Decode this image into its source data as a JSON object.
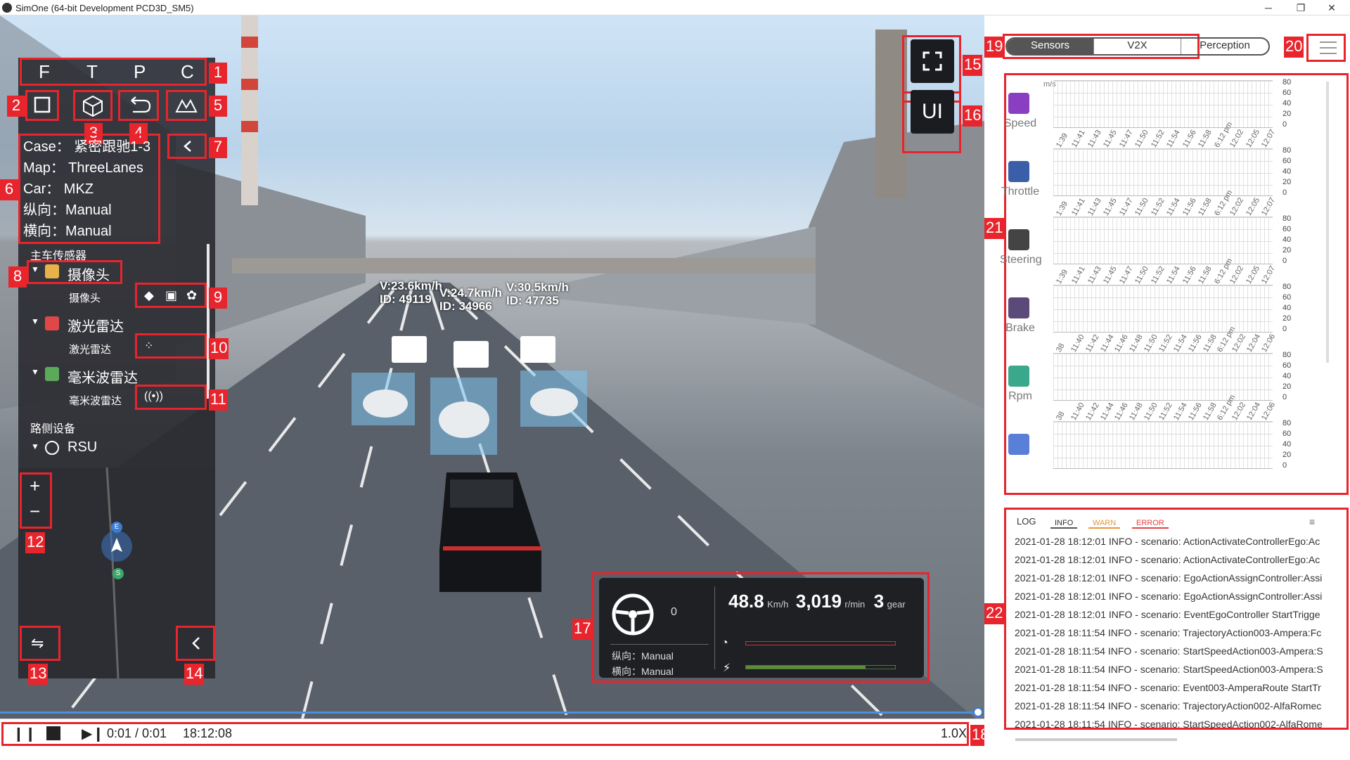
{
  "window": {
    "title": "SimOne (64-bit Development PCD3D_SM5)"
  },
  "view_modes": [
    "F",
    "T",
    "P",
    "C"
  ],
  "toolbar_icons": [
    "square-view-icon",
    "cube-view-icon",
    "undo-icon",
    "terrain-icon"
  ],
  "case_info": {
    "case_label": "Case：",
    "case_value": "紧密跟驰1-3",
    "map_label": "Map：",
    "map_value": "ThreeLanes",
    "car_label": "Car：",
    "car_value": "MKZ",
    "long_label": "纵向：",
    "long_value": "Manual",
    "lat_label": "横向：",
    "lat_value": "Manual"
  },
  "sensors": {
    "section_title": "主车传感器",
    "groups": [
      {
        "name": "摄像头",
        "item": "摄像头",
        "color": "#e8b24a"
      },
      {
        "name": "激光雷达",
        "item": "激光雷达",
        "color": "#e04848"
      },
      {
        "name": "毫米波雷达",
        "item": "毫米波雷达",
        "color": "#5aaa5a"
      }
    ],
    "roadside_title": "路侧设备",
    "roadside_item": "RSU"
  },
  "vehicles": [
    {
      "speed": "V:23.6km/h",
      "id": "ID:  49119"
    },
    {
      "speed": "V:24.7km/h",
      "id": "ID:  34966"
    },
    {
      "speed": "V:30.5km/h",
      "id": "ID:  47735"
    }
  ],
  "minimap": {
    "zoom_in": "+",
    "zoom_out": "−",
    "marker_e": "E",
    "marker_s": "S"
  },
  "dashboard": {
    "steer_value": "0",
    "long_label": "纵向：",
    "long_value": "Manual",
    "lat_label": "横向：",
    "lat_value": "Manual",
    "speed": "48.8",
    "speed_unit": "Km/h",
    "rpm": "3,019",
    "rpm_unit": "r/min",
    "gear": "3",
    "gear_unit": "gear",
    "brake_level": 0.0,
    "throttle_level": 0.8
  },
  "ui_button": "UI",
  "callouts": [
    "1",
    "2",
    "3",
    "4",
    "5",
    "6",
    "7",
    "8",
    "9",
    "10",
    "11",
    "12",
    "13",
    "14",
    "15",
    "16",
    "17",
    "18",
    "19",
    "20",
    "21",
    "22"
  ],
  "right_tabs": [
    "Sensors",
    "V2X",
    "Perception"
  ],
  "charts": {
    "unit": "m/s",
    "y_ticks": [
      "80",
      "60",
      "40",
      "20",
      "0"
    ],
    "rows": [
      {
        "label": "Speed",
        "color": "#8a3fc2",
        "x_ticks": [
          "1:39",
          "11:41",
          "11:43",
          "11:45",
          "11:47",
          "11:50",
          "11:52",
          "11:54",
          "11:56",
          "11:58",
          "6:12 pm",
          "12:02",
          "12:05",
          "12:07"
        ]
      },
      {
        "label": "Throttle",
        "color": "#3a5fa8",
        "x_ticks": [
          "1:39",
          "11:41",
          "11:43",
          "11:45",
          "11:47",
          "11:50",
          "11:52",
          "11:54",
          "11:56",
          "11:58",
          "6:12 pm",
          "12:02",
          "12:05",
          "12:07"
        ]
      },
      {
        "label": "Steering",
        "color": "#444444",
        "x_ticks": [
          "1:39",
          "11:41",
          "11:43",
          "11:45",
          "11:47",
          "11:50",
          "11:52",
          "11:54",
          "11:56",
          "11:58",
          "6:12 pm",
          "12:02",
          "12:05",
          "12:07"
        ]
      },
      {
        "label": "Brake",
        "color": "#5a4a7a",
        "x_ticks": [
          "38",
          "11:40",
          "11:42",
          "11:44",
          "11:46",
          "11:48",
          "11:50",
          "11:52",
          "11:54",
          "11:56",
          "11:58",
          "6:12 pm",
          "12:02",
          "12:04",
          "12:06"
        ]
      },
      {
        "label": "Rpm",
        "color": "#3aa88a",
        "x_ticks": [
          "38",
          "11:40",
          "11:42",
          "11:44",
          "11:46",
          "11:48",
          "11:50",
          "11:52",
          "11:54",
          "11:56",
          "11:58",
          "6:12 pm",
          "12:02",
          "12:04",
          "12:06"
        ]
      },
      {
        "label": "",
        "color": "#5a7fd6",
        "x_ticks": []
      }
    ]
  },
  "log": {
    "title": "LOG",
    "filters": {
      "info": "INFO",
      "warn": "WARN",
      "error": "ERROR"
    },
    "lines": [
      "2021-01-28 18:12:01 INFO - scenario: ActionActivateControllerEgo:Ac",
      "2021-01-28 18:12:01 INFO - scenario: ActionActivateControllerEgo:Ac",
      "2021-01-28 18:12:01 INFO - scenario: EgoActionAssignController:Assi",
      "2021-01-28 18:12:01 INFO - scenario: EgoActionAssignController:Assi",
      "2021-01-28 18:12:01 INFO - scenario: EventEgoController StartTrigge",
      "2021-01-28 18:11:54 INFO - scenario: TrajectoryAction003-Ampera:Fc",
      "2021-01-28 18:11:54 INFO - scenario: StartSpeedAction003-Ampera:S",
      "2021-01-28 18:11:54 INFO - scenario: StartSpeedAction003-Ampera:S",
      "2021-01-28 18:11:54 INFO - scenario: Event003-AmperaRoute StartTr",
      "2021-01-28 18:11:54 INFO - scenario: TrajectoryAction002-AlfaRomec",
      "2021-01-28 18:11:54 INFO - scenario: StartSpeedAction002-AlfaRome"
    ]
  },
  "playback": {
    "time": "0:01 / 0:01",
    "clock": "18:12:08",
    "speed": "1.0X",
    "progress": 1.0
  }
}
